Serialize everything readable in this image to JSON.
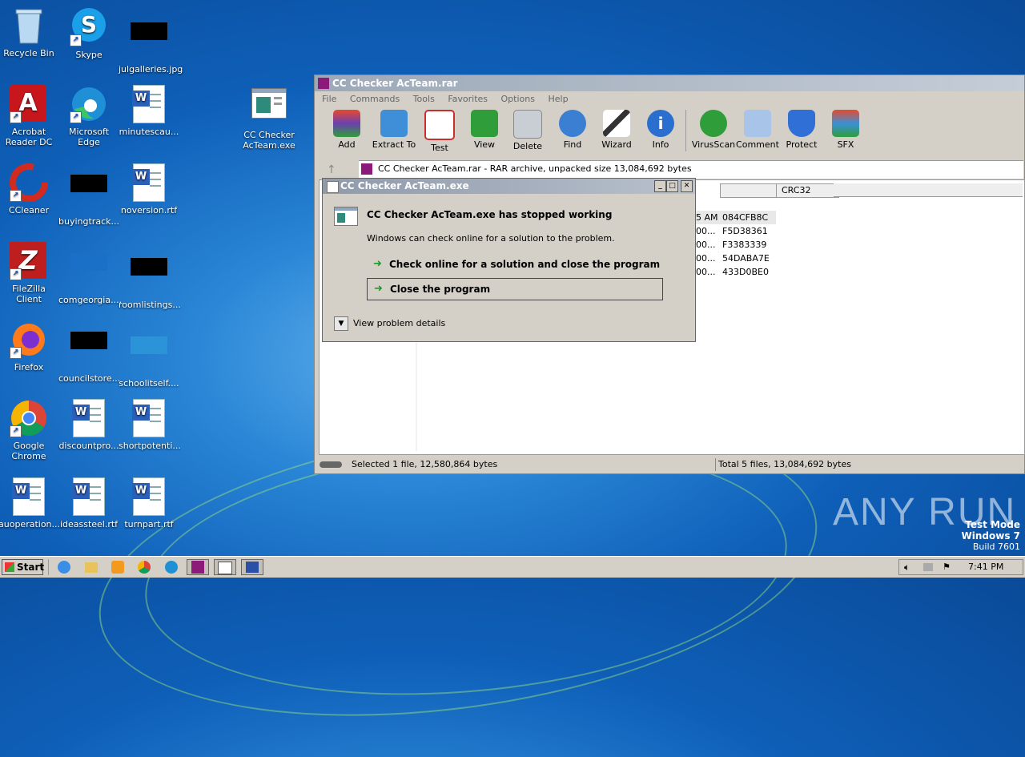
{
  "desktop": {
    "icons": [
      {
        "label": "Recycle Bin"
      },
      {
        "label": "Skype"
      },
      {
        "label": "julgalleries.jpg"
      },
      {
        "label": "Acrobat Reader DC"
      },
      {
        "label": "Microsoft Edge"
      },
      {
        "label": "minutescau..."
      },
      {
        "label": "CC Checker AcTeam.exe"
      },
      {
        "label": "CCleaner"
      },
      {
        "label": "buyingtrack..."
      },
      {
        "label": "noversion.rtf"
      },
      {
        "label": "FileZilla Client"
      },
      {
        "label": "comgeorgia...."
      },
      {
        "label": "roomlistings..."
      },
      {
        "label": "Firefox"
      },
      {
        "label": "councilstore..."
      },
      {
        "label": "schoolitself...."
      },
      {
        "label": "Google Chrome"
      },
      {
        "label": "discountpro..."
      },
      {
        "label": "shortpotenti..."
      },
      {
        "label": "auoperation...."
      },
      {
        "label": "ideassteel.rtf"
      },
      {
        "label": "turnpart.rtf"
      }
    ]
  },
  "winrar": {
    "title": "CC Checker AcTeam.rar",
    "menu": [
      "File",
      "Commands",
      "Tools",
      "Favorites",
      "Options",
      "Help"
    ],
    "toolbar": [
      "Add",
      "Extract To",
      "Test",
      "View",
      "Delete",
      "Find",
      "Wizard",
      "Info",
      "VirusScan",
      "Comment",
      "Protect",
      "SFX"
    ],
    "address": "CC Checker AcTeam.rar - RAR archive, unpacked size 13,084,692 bytes",
    "column_crc": "CRC32",
    "rows": [
      {
        "modified": "5 AM",
        "crc": "084CFB8C"
      },
      {
        "modified": "00...",
        "crc": "F5D38361"
      },
      {
        "modified": "00...",
        "crc": "F3383339"
      },
      {
        "modified": "00...",
        "crc": "54DABA7E"
      },
      {
        "modified": "00...",
        "crc": "433D0BE0"
      }
    ],
    "status_left": "Selected 1 file, 12,580,864 bytes",
    "status_right": "Total 5 files, 13,084,692 bytes"
  },
  "dialog": {
    "title": "CC Checker AcTeam.exe",
    "heading": "CC Checker AcTeam.exe has stopped working",
    "subtext": "Windows can check online for a solution to the problem.",
    "option1": "Check online for a solution and close the program",
    "option2": "Close the program",
    "details": "View problem details"
  },
  "watermark": {
    "brand": "ANY RUN",
    "mode1": "Test Mode",
    "mode2": "Windows 7",
    "mode3": "Build 7601"
  },
  "taskbar": {
    "start": "Start",
    "clock": "7:41 PM"
  },
  "colors": {
    "accent_green": "#1a9a2a",
    "desktop_blue": "#0e5fb8"
  }
}
